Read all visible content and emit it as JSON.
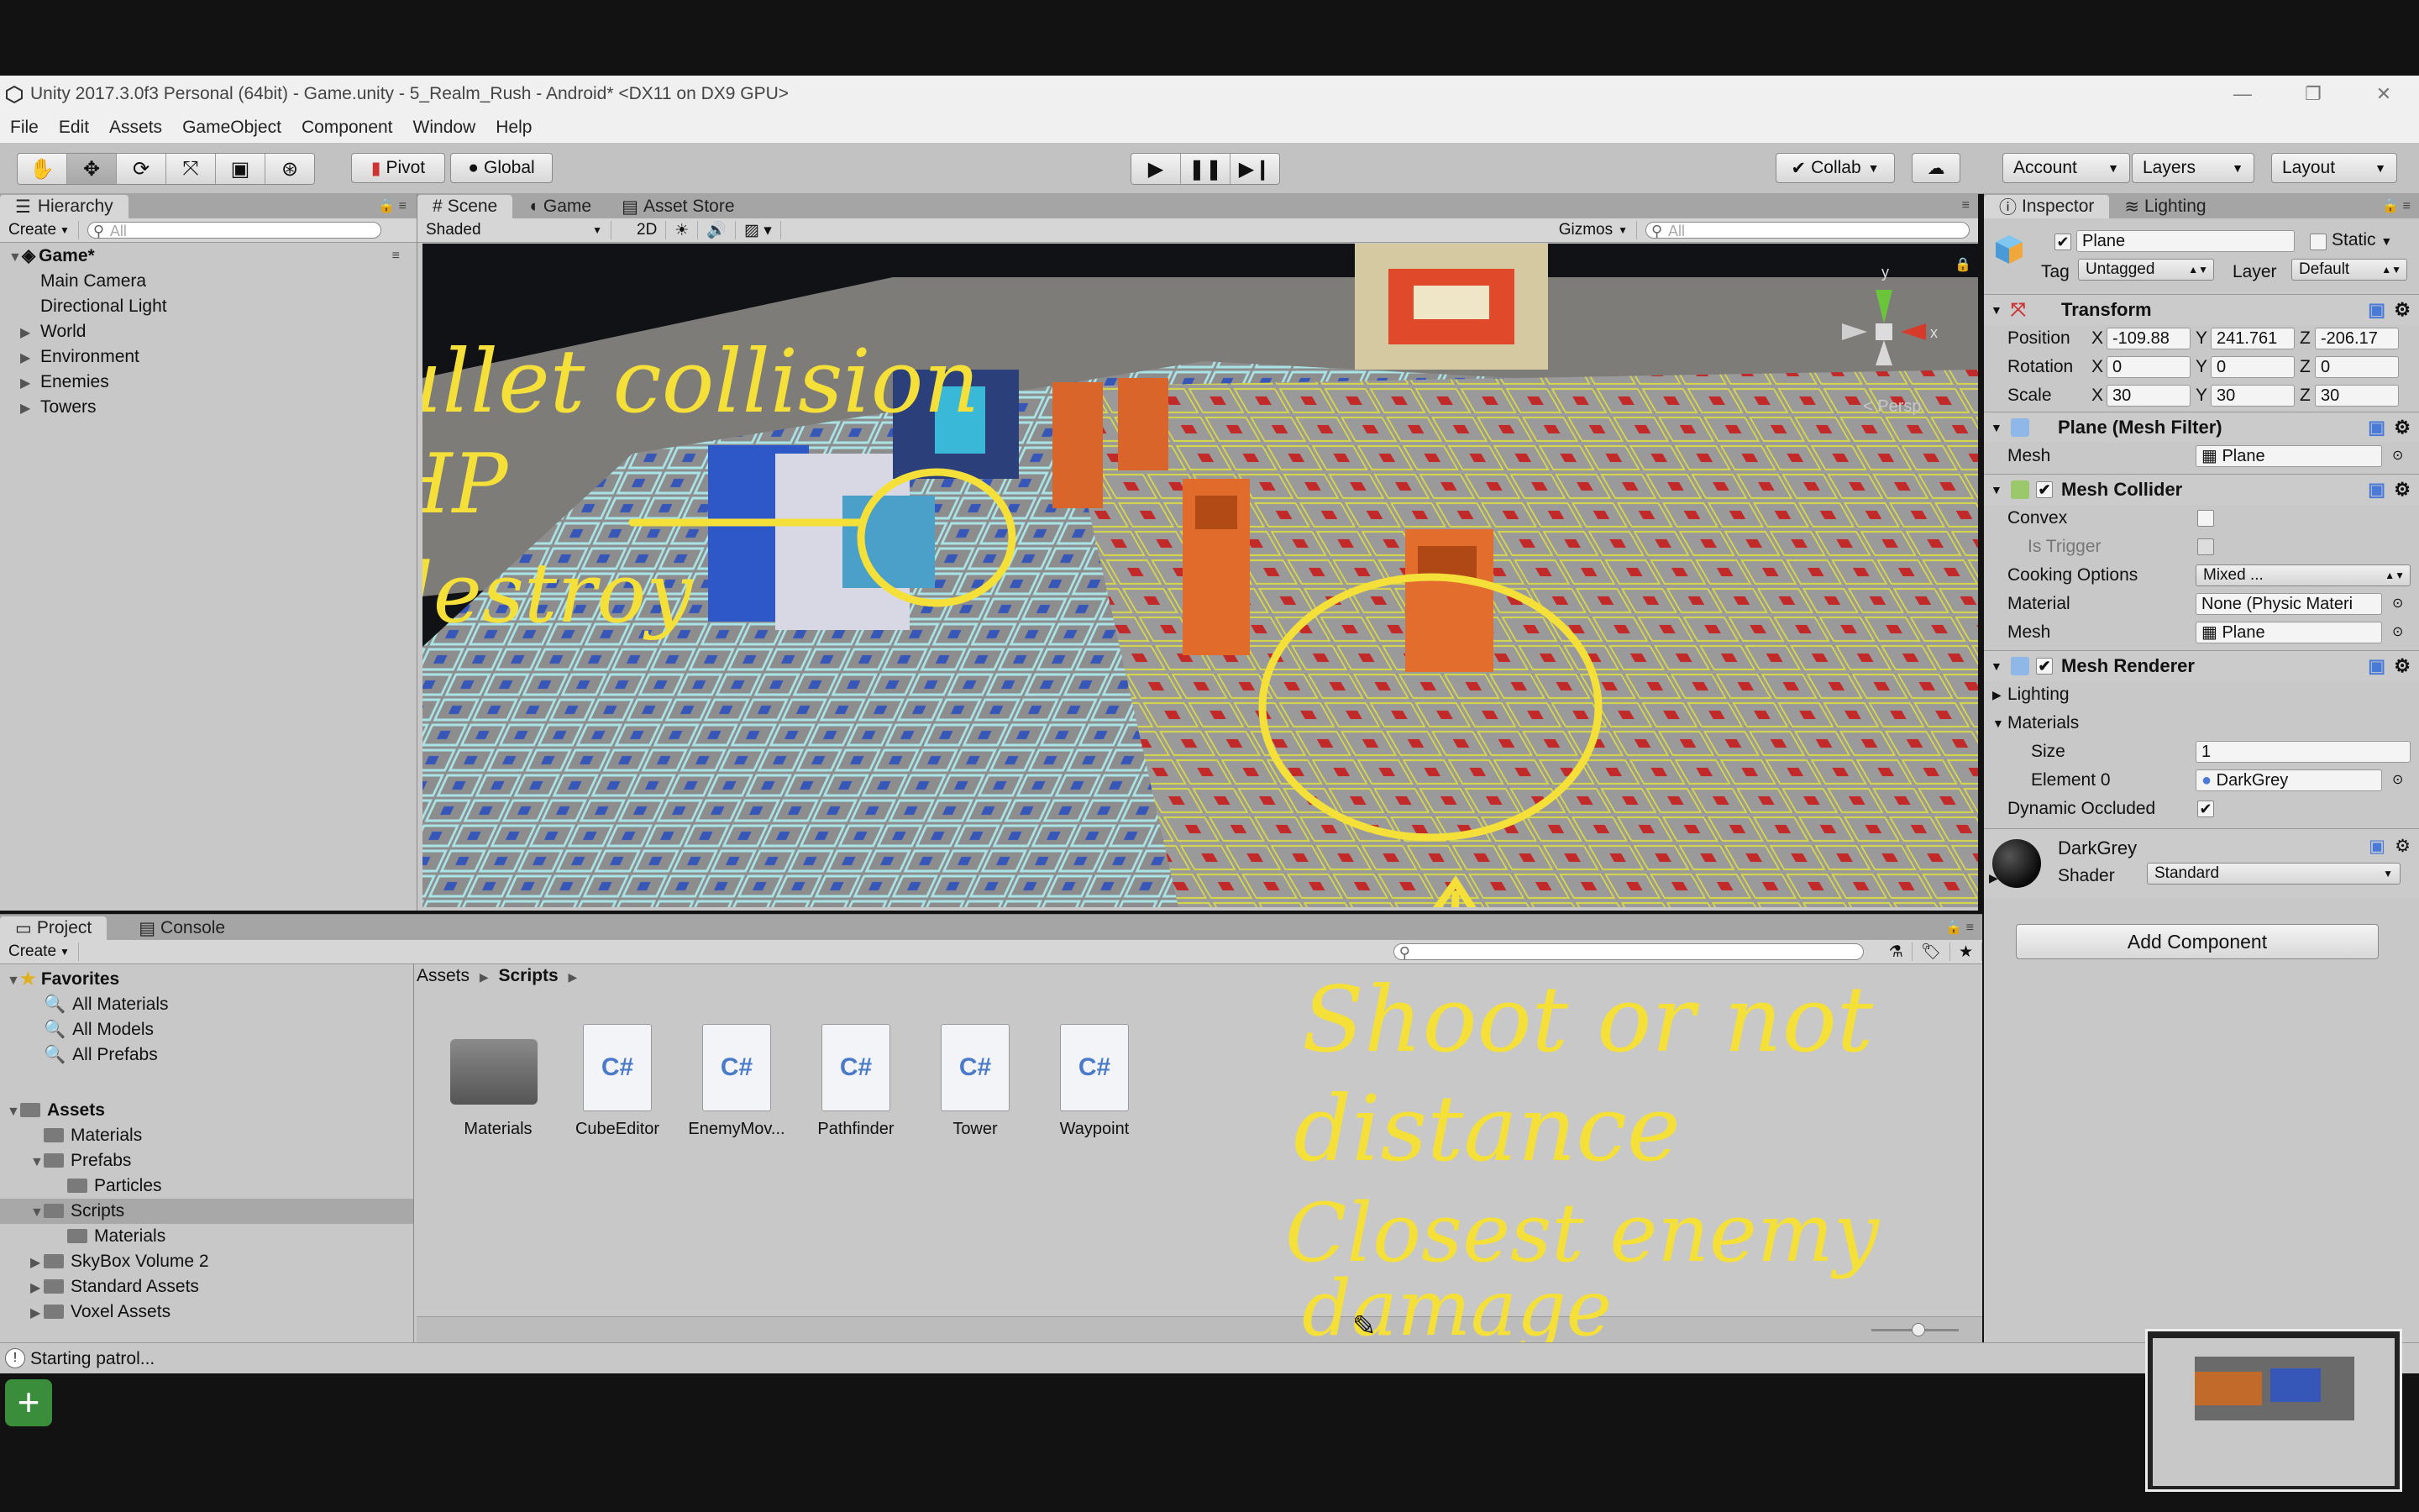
{
  "window": {
    "title": "Unity 2017.3.0f3 Personal (64bit) - Game.unity - 5_Realm_Rush - Android* <DX11 on DX9 GPU>"
  },
  "menu": [
    "File",
    "Edit",
    "Assets",
    "GameObject",
    "Component",
    "Window",
    "Help"
  ],
  "toolbar": {
    "pivot": "Pivot",
    "global": "Global",
    "collab": "Collab",
    "account": "Account",
    "layers": "Layers",
    "layout": "Layout"
  },
  "hierarchy": {
    "tab": "Hierarchy",
    "create": "Create",
    "search_placeholder": "All",
    "scene": "Game*",
    "items": [
      {
        "label": "Main Camera",
        "expandable": false
      },
      {
        "label": "Directional Light",
        "expandable": false
      },
      {
        "label": "World",
        "expandable": true
      },
      {
        "label": "Environment",
        "expandable": true
      },
      {
        "label": "Enemies",
        "expandable": true
      },
      {
        "label": "Towers",
        "expandable": true
      }
    ]
  },
  "scene": {
    "tabs": [
      "Scene",
      "Game",
      "Asset Store"
    ],
    "shading": "Shaded",
    "mode_2d": "2D",
    "gizmos": "Gizmos",
    "search_placeholder": "All",
    "persp": "Persp",
    "axis_y": "y",
    "axis_x": "x"
  },
  "annotations_top": [
    "bullet collision",
    "HP",
    "destroy"
  ],
  "annotations_bottom": [
    "Shoot or not",
    "distance",
    "Closest enemy",
    "damage"
  ],
  "inspector": {
    "tabs": [
      "Inspector",
      "Lighting"
    ],
    "object_name": "Plane",
    "static": "Static",
    "tag_label": "Tag",
    "tag": "Untagged",
    "layer_label": "Layer",
    "layer": "Default",
    "transform": {
      "title": "Transform",
      "position": {
        "label": "Position",
        "x": "-109.88",
        "y": "241.761",
        "z": "-206.17"
      },
      "rotation": {
        "label": "Rotation",
        "x": "0",
        "y": "0",
        "z": "0"
      },
      "scale": {
        "label": "Scale",
        "x": "30",
        "y": "30",
        "z": "30"
      }
    },
    "mesh_filter": {
      "title": "Plane (Mesh Filter)",
      "mesh_label": "Mesh",
      "mesh": "Plane"
    },
    "mesh_collider": {
      "title": "Mesh Collider",
      "convex": "Convex",
      "is_trigger": "Is Trigger",
      "cooking_label": "Cooking Options",
      "cooking": "Mixed ...",
      "material_label": "Material",
      "material": "None (Physic Materi",
      "mesh_label": "Mesh",
      "mesh": "Plane"
    },
    "mesh_renderer": {
      "title": "Mesh Renderer",
      "lighting": "Lighting",
      "materials": "Materials",
      "size_label": "Size",
      "size": "1",
      "element_label": "Element 0",
      "element": "DarkGrey",
      "dyn_label": "Dynamic Occluded"
    },
    "material": {
      "name": "DarkGrey",
      "shader_label": "Shader",
      "shader": "Standard"
    },
    "add_component": "Add Component"
  },
  "project": {
    "tabs": [
      "Project",
      "Console"
    ],
    "create": "Create",
    "favorites": {
      "title": "Favorites",
      "items": [
        "All Materials",
        "All Models",
        "All Prefabs"
      ]
    },
    "assets_tree": {
      "title": "Assets",
      "items": [
        {
          "label": "Materials",
          "indent": 1,
          "expandable": false
        },
        {
          "label": "Prefabs",
          "indent": 1,
          "expandable": true
        },
        {
          "label": "Particles",
          "indent": 2,
          "expandable": false
        },
        {
          "label": "Scripts",
          "indent": 1,
          "expandable": true,
          "selected": true
        },
        {
          "label": "Materials",
          "indent": 2,
          "expandable": false
        },
        {
          "label": "SkyBox Volume 2",
          "indent": 1,
          "expandable": true
        },
        {
          "label": "Standard Assets",
          "indent": 1,
          "expandable": true
        },
        {
          "label": "Voxel Assets",
          "indent": 1,
          "expandable": true
        }
      ]
    },
    "breadcrumb": [
      "Assets",
      "Scripts"
    ],
    "files": [
      {
        "name": "Materials",
        "type": "folder"
      },
      {
        "name": "CubeEditor",
        "type": "script"
      },
      {
        "name": "EnemyMov...",
        "type": "script"
      },
      {
        "name": "Pathfinder",
        "type": "script"
      },
      {
        "name": "Tower",
        "type": "script"
      },
      {
        "name": "Waypoint",
        "type": "script"
      }
    ]
  },
  "status": "Starting patrol...",
  "script_icon_text": "C#"
}
